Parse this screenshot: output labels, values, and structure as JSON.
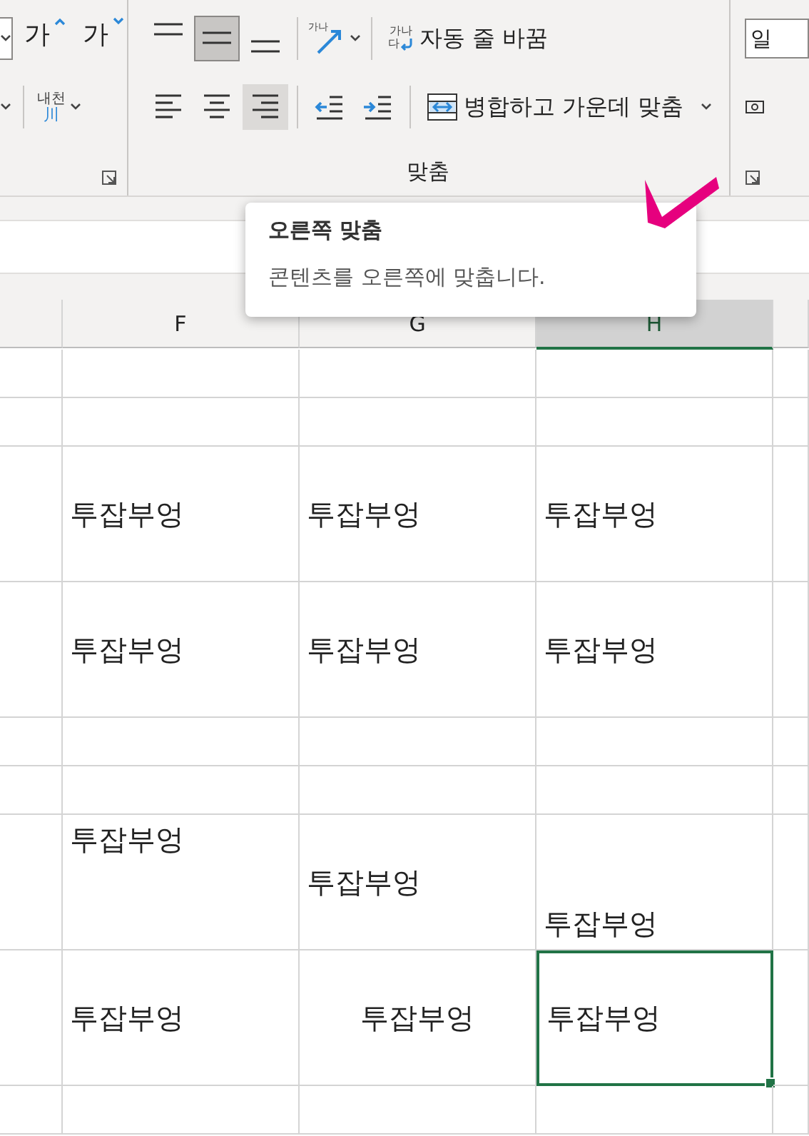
{
  "ribbon": {
    "font_group": {
      "grow_glyph": "가",
      "shrink_glyph": "가",
      "phonetic_top": "내천",
      "phonetic_bottom": "川"
    },
    "alignment_group": {
      "label": "맞춤",
      "vertical_buttons": [
        {
          "kind": "top",
          "selected": false
        },
        {
          "kind": "middle",
          "selected": true
        },
        {
          "kind": "bottom",
          "selected": false
        }
      ],
      "orientation": {
        "glyph": "가나"
      },
      "horizontal_buttons": [
        {
          "kind": "left",
          "selected": false
        },
        {
          "kind": "center",
          "selected": false
        },
        {
          "kind": "right",
          "selected": true
        }
      ],
      "indent_buttons": [
        {
          "kind": "decrease"
        },
        {
          "kind": "increase"
        }
      ],
      "wrap_text": {
        "glyph_top": "가나",
        "glyph_bottom": "다",
        "label": "자동 줄 바꿈"
      },
      "merge": {
        "label": "병합하고 가운데 맞춤"
      }
    },
    "number_group": {
      "format": "일"
    }
  },
  "tooltip": {
    "title": "오른쪽 맞춤",
    "description": "콘텐츠를 오른쪽에 맞춥니다."
  },
  "sheet": {
    "columns": [
      {
        "label": "F",
        "selected": false
      },
      {
        "label": "G",
        "selected": false
      },
      {
        "label": "H",
        "selected": true
      }
    ],
    "rows": [
      {},
      {},
      {
        "cells": [
          {
            "text": "투잡부엉",
            "kind": "left",
            "selected": false
          },
          {
            "text": "투잡부엉",
            "kind": "left",
            "selected": false
          },
          {
            "text": "투잡부엉",
            "kind": "left",
            "selected": false
          }
        ]
      },
      {
        "cells": [
          {
            "text": "투잡부엉",
            "kind": "left",
            "selected": false
          },
          {
            "text": "투잡부엉",
            "kind": "left",
            "selected": false
          },
          {
            "text": "투잡부엉",
            "kind": "left",
            "selected": false
          }
        ]
      },
      {},
      {},
      {
        "cells": [
          {
            "text": "투잡부엉",
            "kind": "top",
            "selected": false
          },
          {
            "text": "투잡부엉",
            "kind": "left",
            "selected": false
          },
          {
            "text": "투잡부엉",
            "kind": "bottom",
            "selected": false
          }
        ]
      },
      {
        "cells": [
          {
            "text": "투잡부엉",
            "kind": "left",
            "selected": false
          },
          {
            "text": "투잡부엉",
            "kind": "center",
            "selected": false
          },
          {
            "text": "투잡부엉",
            "kind": "left",
            "selected": true
          }
        ]
      },
      {}
    ]
  }
}
